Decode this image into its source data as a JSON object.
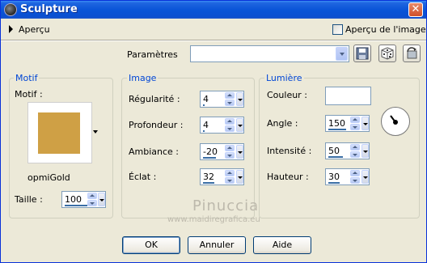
{
  "window": {
    "title": "Sculpture"
  },
  "preview": {
    "label": "Aperçu",
    "image_preview_label": "Aperçu de l'image",
    "image_preview_checked": false
  },
  "params": {
    "label": "Paramètres",
    "value": ""
  },
  "motif_group": {
    "title": "Motif",
    "motif_label": "Motif :",
    "swatch_color": "#cfa045",
    "pattern_name": "opmiGold",
    "size_label": "Taille :",
    "size_value": "100"
  },
  "image_group": {
    "title": "Image",
    "rows": [
      {
        "label": "Régularité :",
        "value": "4"
      },
      {
        "label": "Profondeur :",
        "value": "4"
      },
      {
        "label": "Ambiance :",
        "value": "-20"
      },
      {
        "label": "Éclat :",
        "value": "32"
      }
    ]
  },
  "light_group": {
    "title": "Lumière",
    "color_label": "Couleur :",
    "color_value": "#ffffff",
    "rows": [
      {
        "label": "Angle :",
        "value": "150"
      },
      {
        "label": "Intensité :",
        "value": "50"
      },
      {
        "label": "Hauteur :",
        "value": "30"
      }
    ]
  },
  "watermark": {
    "line1": "Pinuccia",
    "line2": "www.maidiregrafica.eu"
  },
  "buttons": {
    "ok": "OK",
    "cancel": "Annuler",
    "help": "Aide"
  },
  "colors": {
    "title_bar": "#0a55d8",
    "group_title": "#0046d5",
    "dialog_bg": "#ece9d8"
  }
}
